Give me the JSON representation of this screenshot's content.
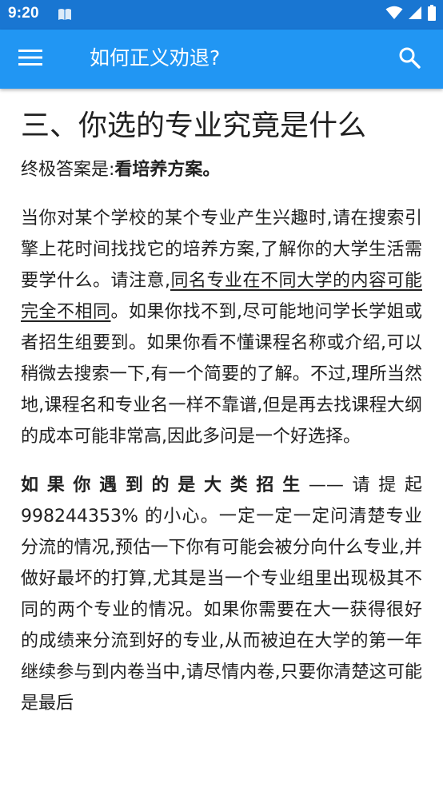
{
  "status_bar": {
    "time": "9:20",
    "icons": [
      "notification-book-icon",
      "wifi-icon",
      "cell-signal-icon",
      "battery-icon"
    ]
  },
  "app_bar": {
    "title": "如何正义劝退?",
    "menu_icon": "hamburger-menu-icon",
    "search_icon": "search-icon",
    "color": "#2196f3",
    "status_color": "#1976d2"
  },
  "article": {
    "heading": "三、你选的专业究竟是什么",
    "answer_prefix": "终极答案是:",
    "answer_bold": "看培养方案。",
    "p1_before": "当你对某个学校的某个专业产生兴趣时,请在搜索引擎上花时间找找它的培养方案,了解你的大学生活需要学什么。请注意,",
    "p1_underline": "同名专业在不同大学的内容可能完全不相同",
    "p1_after": "。如果你找不到,尽可能地问学长学姐或者招生组要到。如果你看不懂课程名称或介绍,可以稍微去搜索一下,有一个简要的了解。不过,理所当然地,课程名和专业名一样不靠谱,但是再去找课程大纲的成本可能非常高,因此多问是一个好选择。",
    "p2_bold": "如果你遇到的是大类招生",
    "p2_rest": "——请提起 998244353% 的小心。一定一定一定问清楚专业分流的情况,预估一下你有可能会被分向什么专业,并做好最坏的打算,尤其是当一个专业组里出现极其不同的两个专业的情况。如果你需要在大一获得很好的成绩来分流到好的专业,从而被迫在大学的第一年继续参与到内卷当中,请尽情内卷,只要你清楚这可能是最后"
  }
}
